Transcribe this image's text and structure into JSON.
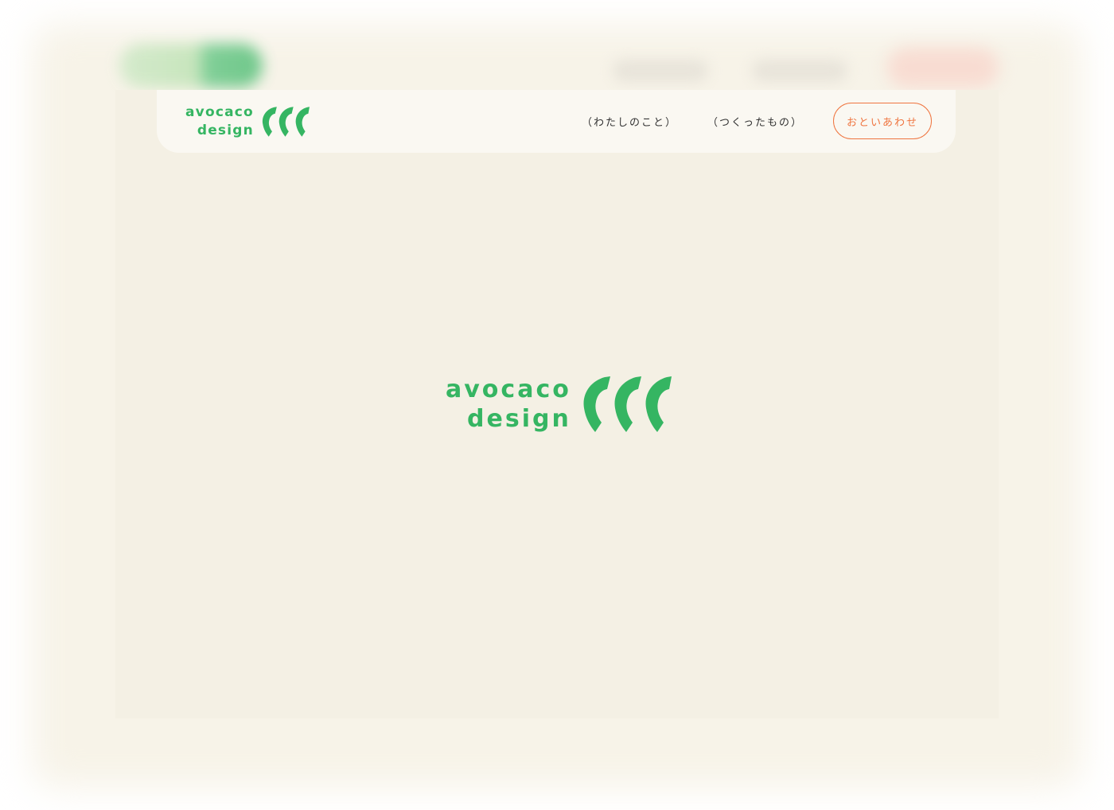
{
  "brand": {
    "line1": "avocaco",
    "line2": "design",
    "color": "#35b562"
  },
  "nav": {
    "about_label": "（わたしのこと）",
    "works_label": "（つくったもの）",
    "contact_label": "おといあわせ",
    "contact_color": "#ef7540"
  },
  "hero": {
    "line1": "avocaco",
    "line2": "design"
  },
  "colors": {
    "background": "#f4f0e4",
    "header": "#faf8f2",
    "text": "#333333"
  }
}
